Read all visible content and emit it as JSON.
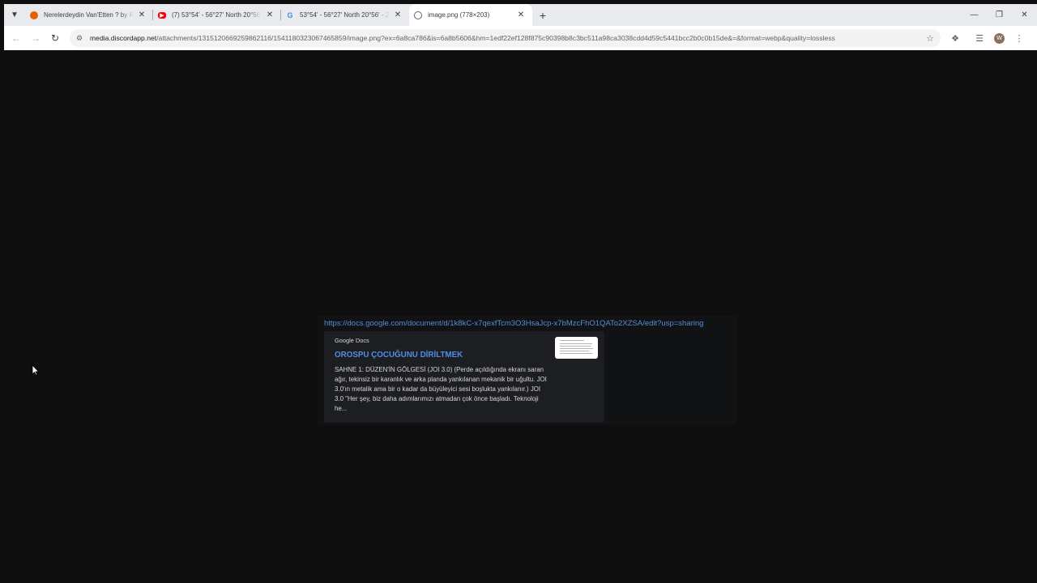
{
  "browser": {
    "tabs": [
      {
        "title": "Nerelerdeydin Van'Etten ? by Ki",
        "favicon": "firefox-icon",
        "favicon_color": "#e66000",
        "active": false
      },
      {
        "title": "(7) 53°54' - 56°27' North 20°56'",
        "favicon": "youtube-icon",
        "favicon_color": "#ff0000",
        "active": false
      },
      {
        "title": "53°54' - 56°27' North 20°56' - 2",
        "favicon": "google-icon",
        "favicon_color": "#4285f4",
        "active": false
      },
      {
        "title": "image.png (778×203)",
        "favicon": "globe-icon",
        "favicon_color": "#5f6368",
        "active": true
      }
    ],
    "new_tab_symbol": "+",
    "url_host": "media.discordapp.net",
    "url_rest": "/attachments/1315120669259862116/1541180323067465859/image.png?ex=6a8ca786&is=6a8b5606&hm=1edf22ef128f875c90398b8c3bc511a98ca3038cdd4d59c5441bcc2b0c0b15de&=&format=webp&quality=lossless",
    "profile_initial": "W"
  },
  "embed": {
    "link": "https://docs.google.com/document/d/1k8kC-x7qexfTcm3O3HsaJcp-x7bMzcFhO1QATo2XZSA/edit?usp=sharing",
    "provider": "Google Docs",
    "title": "OROSPU ÇOCUĞUNU DİRİLTMEK",
    "description": "SAHNE 1: DÜZEN'İN GÖLGESİ (JOI 3.0) (Perde açıldığında ekranı saran ağır, tekinsiz bir karanlık ve arka planda yankılanan mekanik bir uğultu. JOI 3.0'ın metalik ama bir o kadar da büyüleyici sesi boşlukta yankılanır.) JOI 3.0 \"Her şey, biz daha adımlarımızı atmadan çok önce başladı. Teknoloji he..."
  }
}
